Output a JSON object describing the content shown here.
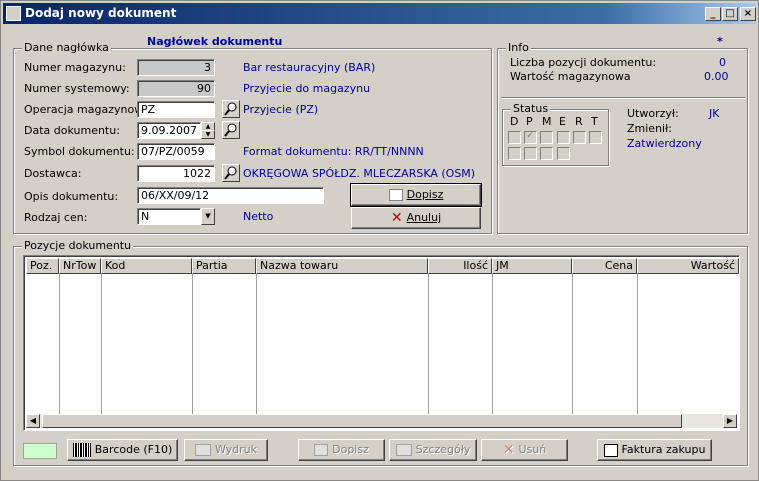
{
  "window": {
    "title": "Dodaj nowy dokument"
  },
  "header_group": {
    "legend": "Dane nagłówka",
    "section_title": "Nagłówek dokumentu",
    "marker": "*",
    "fields": {
      "magazyn_label": "Numer magazynu:",
      "magazyn_value": "3",
      "magazyn_desc": "Bar restauracyjny (BAR)",
      "systemowy_label": "Numer systemowy:",
      "systemowy_value": "90",
      "systemowy_desc": "Przyjecie do magazynu",
      "operacja_label": "Operacja magazynowa:",
      "operacja_value": "PZ",
      "operacja_desc": "Przyjecie (PZ)",
      "data_label": "Data dokumentu:",
      "data_value": "9.09.2007",
      "symbol_label": "Symbol dokumentu:",
      "symbol_value": "07/PZ/0059",
      "symbol_desc": "Format dokumentu: RR/TT/NNNN",
      "dostawca_label": "Dostawca:",
      "dostawca_value": "1022",
      "dostawca_desc": "OKRĘGOWA SPÓŁDZ. MLECZARSKA (OSM)",
      "opis_label": "Opis dokumentu:",
      "opis_value": "06/XX/09/12",
      "rodzaj_label": "Rodzaj cen:",
      "rodzaj_value": "N",
      "rodzaj_desc": "Netto"
    },
    "buttons": {
      "dopisz": "Dopisz",
      "anuluj": "Anuluj"
    }
  },
  "info_group": {
    "legend": "Info",
    "liczba_label": "Liczba pozycji dokumentu:",
    "liczba_value": "0",
    "wartosc_label": "Wartość magazynowa",
    "wartosc_value": "0.00",
    "status_legend": "Status",
    "status_letters": [
      "D",
      "P",
      "M",
      "E",
      "R",
      "T"
    ],
    "utworzyl_label": "Utworzył:",
    "utworzyl_value": "JK",
    "zmienil_label": "Zmienił:",
    "state": "Zatwierdzony"
  },
  "items_group": {
    "legend": "Pozycje dokumentu",
    "columns": [
      "Poz.",
      "NrTow",
      "Kod",
      "Partia",
      "Nazwa towaru",
      "Ilość",
      "JM",
      "Cena",
      "Wartość"
    ]
  },
  "toolbar": {
    "barcode": "Barcode (F10)",
    "wydruk": "Wydruk",
    "dopisz": "Dopisz",
    "szczegoly": "Szczegóły",
    "usun": "Usuń",
    "faktura": "Faktura zakupu"
  },
  "colors": {
    "title_start": "#0a246a",
    "accent_text": "#0000a0",
    "status_swatch": "#ccffcc"
  }
}
